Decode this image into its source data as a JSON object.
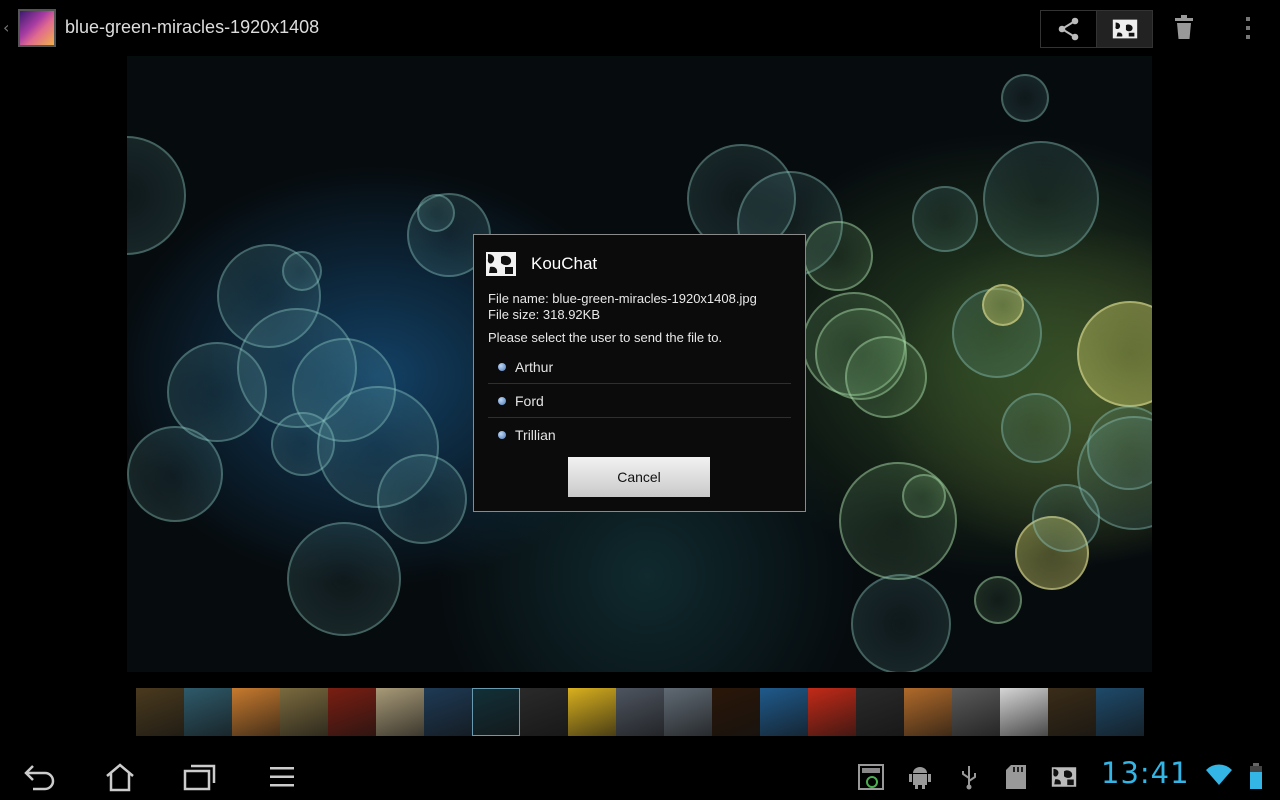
{
  "action_bar": {
    "title": "blue-green-miracles-1920x1408",
    "up_icon": "chevron-left-icon",
    "actions": [
      "share-icon",
      "kouchat-icon",
      "trash-icon",
      "overflow-menu-icon"
    ]
  },
  "dialog": {
    "title": "KouChat",
    "file_name": "File name: blue-green-miracles-1920x1408.jpg",
    "file_size": "File size: 318.92KB",
    "prompt": "Please select the user to send the file to.",
    "users": [
      "Arthur",
      "Ford",
      "Trillian"
    ],
    "cancel_label": "Cancel"
  },
  "filmstrip": {
    "selected_index": 7,
    "thumb_colors": [
      "#4a3a1e",
      "#2e5a6a",
      "#c77a2e",
      "#7a6a3e",
      "#7a1e12",
      "#a89a78",
      "#1e3a55",
      "#123038",
      "#2a2a2a",
      "#d9b01e",
      "#4e5560",
      "#606a74",
      "#2a1608",
      "#1f5a8c",
      "#c22a18",
      "#2a2a2a",
      "#b06a2a",
      "#5a5a5a",
      "#d5d5d5",
      "#3a2c18",
      "#1e4a6a"
    ]
  },
  "system_bar": {
    "clock": "13:41",
    "nav": [
      "back-icon",
      "home-icon",
      "recent-apps-icon",
      "menu-icon"
    ],
    "notifications": [
      "screenshot-icon",
      "android-debug-icon",
      "usb-icon",
      "sd-card-icon",
      "kouchat-notification-icon",
      "wifi-icon",
      "battery-icon"
    ],
    "accent_color": "#33b5e5"
  }
}
